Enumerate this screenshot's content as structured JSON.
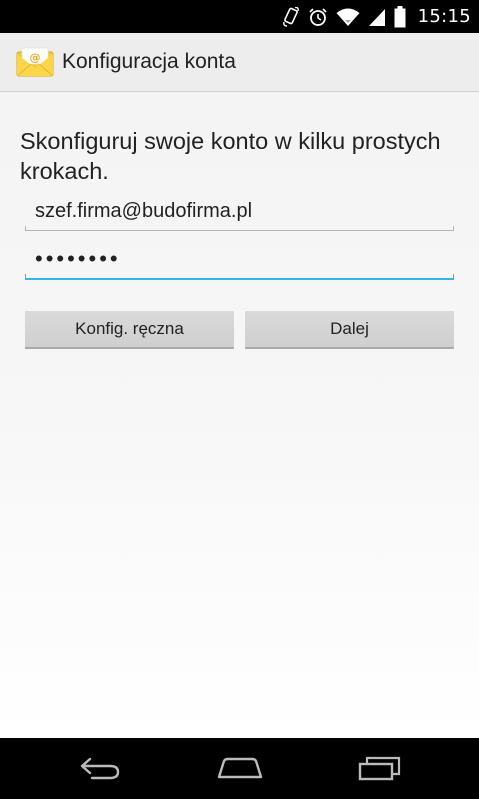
{
  "status_bar": {
    "time": "15:15",
    "icons": [
      "rotation-icon",
      "alarm-icon",
      "wifi-icon",
      "signal-icon",
      "battery-icon"
    ]
  },
  "action_bar": {
    "title": "Konfiguracja konta",
    "icon": "email-app-icon"
  },
  "form": {
    "intro": "Skonfiguruj swoje konto w kilku prostych krokach.",
    "email_value": "szef.firma@budofirma.pl",
    "password_masked": "••••••••"
  },
  "buttons": {
    "manual_label": "Konfig. ręczna",
    "next_label": "Dalej"
  },
  "nav_bar": {
    "icons": [
      "back-icon",
      "home-icon",
      "recent-apps-icon"
    ]
  },
  "colors": {
    "accent": "#33b5e5",
    "button": "#d4d4d4",
    "action_bar": "#ededed"
  }
}
